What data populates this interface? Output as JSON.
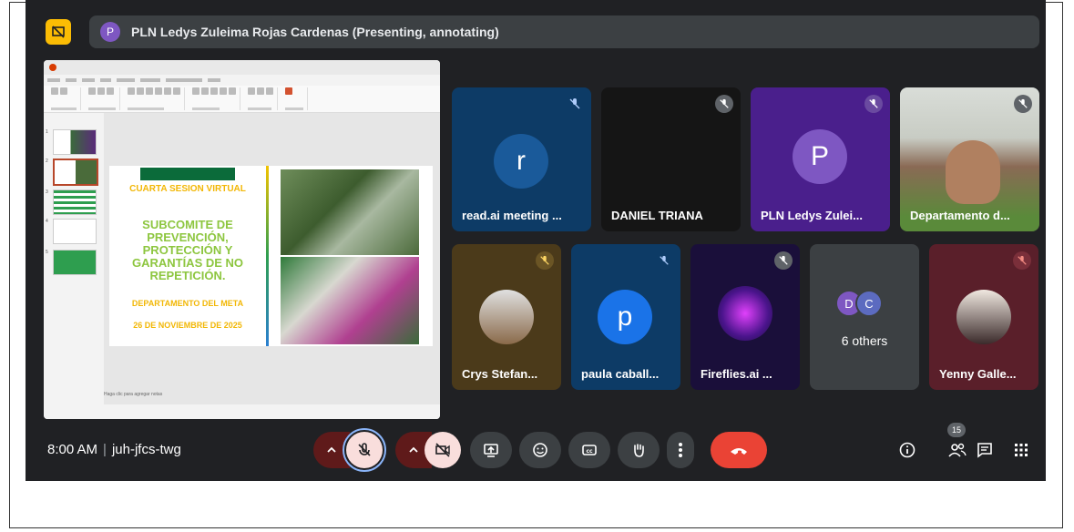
{
  "presenter": {
    "initial": "P",
    "text": "PLN Ledys Zuleima Rojas Cardenas (Presenting, annotating)"
  },
  "slide": {
    "thumb_numbers": [
      "1",
      "2",
      "3",
      "4",
      "5"
    ],
    "line1": "CUARTA SESION VIRTUAL",
    "line2": "SUBCOMITE DE PREVENCIÓN, PROTECCIÓN Y GARANTÍAS DE NO REPETICIÓN.",
    "line3": "DEPARTAMENTO DEL META",
    "line4": "26 DE NOVIEMBRE DE 2025",
    "notes": "Haga clic para agregar notas"
  },
  "participants": [
    {
      "name": "read.ai meeting ...",
      "initial": "r"
    },
    {
      "name": "DANIEL TRIANA"
    },
    {
      "name": "PLN Ledys Zulei...",
      "initial": "P"
    },
    {
      "name": "Departamento d..."
    },
    {
      "name": "Crys Stefan..."
    },
    {
      "name": "paula caball...",
      "initial": "p"
    },
    {
      "name": "Fireflies.ai ..."
    },
    {
      "name": "6 others",
      "initials": [
        "D",
        "C"
      ]
    },
    {
      "name": "Yenny Galle..."
    }
  ],
  "meeting": {
    "time": "8:00 AM",
    "code": "juh-jfcs-twg",
    "people_count": "15"
  },
  "colors": {
    "background": "#202124",
    "end_call": "#ea4335",
    "accent_yellow": "#fbbc04"
  }
}
